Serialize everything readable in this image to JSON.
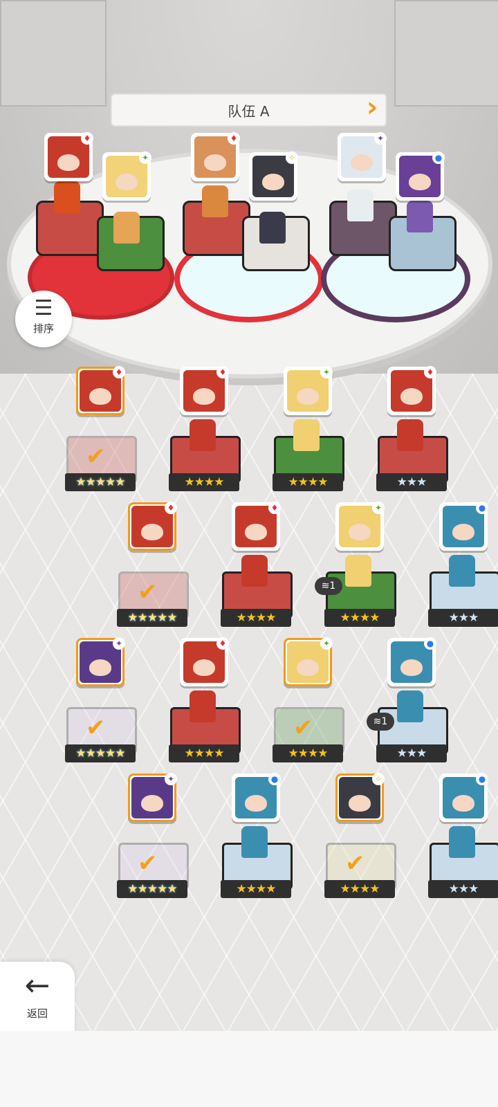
{
  "team": {
    "title": "队伍 A"
  },
  "sort_button": {
    "label": "排序",
    "icon": "sort-icon"
  },
  "back_button": {
    "label": "返回",
    "icon": "arrow-left-icon"
  },
  "colors": {
    "accent": "#f29a1a",
    "red": "#e2323a",
    "green": "#4db339",
    "blue": "#2b7de9",
    "purple": "#6a4aa0"
  },
  "team_slots": [
    {
      "element": "red",
      "badge_icon": "diamond-red-icon"
    },
    {
      "element": "green",
      "badge_icon": "leaf-green-icon"
    },
    {
      "element": "red",
      "badge_icon": "diamond-red-icon"
    },
    {
      "element": "yellow",
      "badge_icon": "sparkle-yellow-icon"
    },
    {
      "element": "purple",
      "badge_icon": "sparkle-purple-icon"
    },
    {
      "element": "blue",
      "badge_icon": "dot-blue-icon"
    }
  ],
  "roster": [
    {
      "element": "red",
      "stars": "★★★★★",
      "selected": true,
      "dup": ""
    },
    {
      "element": "red",
      "stars": "★★★★",
      "selected": false,
      "dup": ""
    },
    {
      "element": "green",
      "stars": "★★★★",
      "selected": false,
      "dup": ""
    },
    {
      "element": "red",
      "stars": "★★★",
      "selected": false,
      "dup": ""
    },
    {
      "element": "red",
      "stars": "★★★★★",
      "selected": true,
      "dup": ""
    },
    {
      "element": "red",
      "stars": "★★★★",
      "selected": false,
      "dup": ""
    },
    {
      "element": "green",
      "stars": "★★★★",
      "selected": false,
      "dup": "1"
    },
    {
      "element": "blue",
      "stars": "★★★",
      "selected": false,
      "dup": ""
    },
    {
      "element": "purple",
      "stars": "★★★★★",
      "selected": true,
      "dup": ""
    },
    {
      "element": "red",
      "stars": "★★★★",
      "selected": false,
      "dup": ""
    },
    {
      "element": "green",
      "stars": "★★★★",
      "selected": true,
      "dup": ""
    },
    {
      "element": "blue",
      "stars": "★★★",
      "selected": false,
      "dup": "1"
    },
    {
      "element": "purple",
      "stars": "★★★★★",
      "selected": true,
      "dup": ""
    },
    {
      "element": "blue",
      "stars": "★★★★",
      "selected": false,
      "dup": ""
    },
    {
      "element": "yellow",
      "stars": "★★★★",
      "selected": true,
      "dup": ""
    },
    {
      "element": "blue",
      "stars": "★★★",
      "selected": false,
      "dup": ""
    }
  ]
}
